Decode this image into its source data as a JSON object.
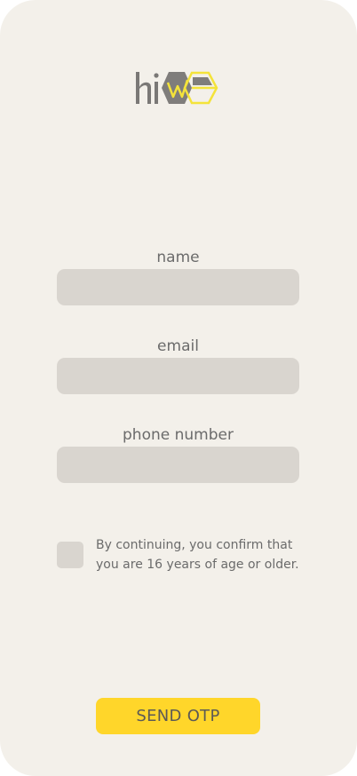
{
  "brand": {
    "logo_text": "hiwe",
    "colors": {
      "gray": "#7a7876",
      "yellow": "#f4e33a"
    }
  },
  "form": {
    "name_label": "name",
    "name_value": "",
    "email_label": "email",
    "email_value": "",
    "phone_label": "phone number",
    "phone_value": ""
  },
  "consent": {
    "checked": false,
    "line1": "By continuing, you confirm that",
    "line2": "you are 16 years of age or older."
  },
  "actions": {
    "send_otp_label": "SEND OTP"
  },
  "theme": {
    "background": "#f3f0ea",
    "input_bg": "#d9d5cf",
    "button_bg": "#ffd62a",
    "text": "#6b6b6b"
  }
}
